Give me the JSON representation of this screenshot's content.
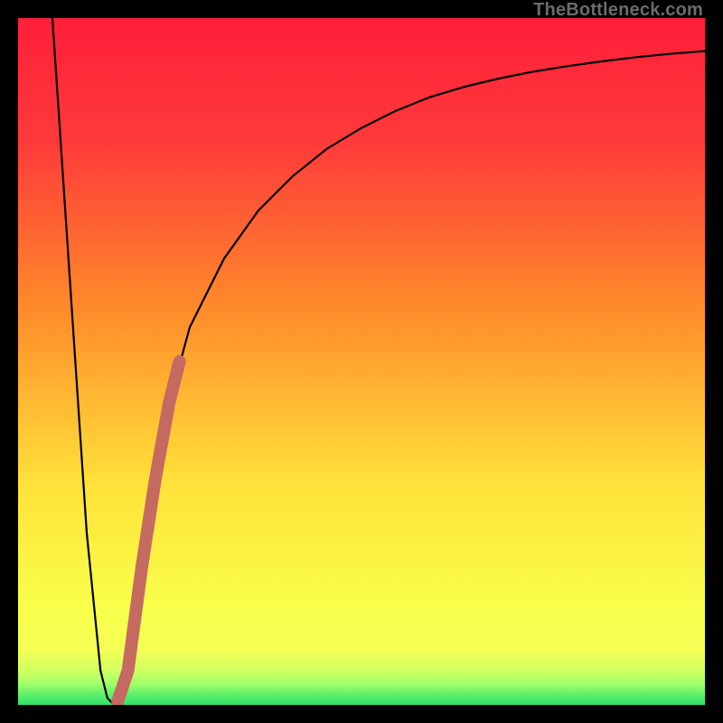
{
  "watermark": "TheBottleneck.com",
  "colors": {
    "background_black": "#000000",
    "gradient_top": "#ff1f3a",
    "gradient_mid1": "#ff8a2a",
    "gradient_mid2": "#ffe23a",
    "gradient_bottom_band": "#f4ff55",
    "gradient_green_light": "#9fff6a",
    "gradient_green": "#2fe06a",
    "curve_black": "#000000",
    "accent_curve": "#c56a60"
  },
  "chart_data": {
    "type": "line",
    "title": "",
    "xlabel": "",
    "ylabel": "",
    "xlim": [
      0,
      100
    ],
    "ylim": [
      0,
      100
    ],
    "series": [
      {
        "name": "bottleneck-curve",
        "x": [
          5,
          6,
          8,
          10,
          12,
          13,
          14,
          15,
          16,
          18,
          20,
          22,
          25,
          30,
          35,
          40,
          45,
          50,
          55,
          60,
          65,
          70,
          75,
          80,
          85,
          90,
          95,
          100
        ],
        "values": [
          100,
          85,
          55,
          25,
          5,
          1,
          0,
          1,
          5,
          20,
          33,
          44,
          55,
          65,
          72,
          77,
          81,
          84,
          86.5,
          88.5,
          90,
          91.2,
          92.2,
          93,
          93.7,
          94.3,
          94.8,
          95.2
        ]
      }
    ],
    "accent_segment": {
      "name": "highlighted-curve-segment",
      "x": [
        14.5,
        16,
        18,
        20,
        22,
        23.5
      ],
      "values": [
        0.5,
        5,
        20,
        33,
        44,
        50
      ]
    }
  }
}
